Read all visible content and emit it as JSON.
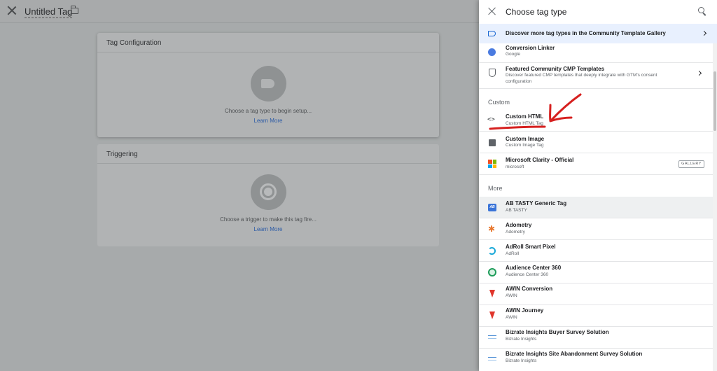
{
  "editor": {
    "tag_title": "Untitled Tag",
    "config_card": {
      "title": "Tag Configuration",
      "hint": "Choose a tag type to begin setup...",
      "link": "Learn More"
    },
    "trigger_card": {
      "title": "Triggering",
      "hint": "Choose a trigger to make this tag fire...",
      "link": "Learn More"
    }
  },
  "panel": {
    "title": "Choose tag type",
    "gallery_banner": "Discover more tag types in the Community Template Gallery",
    "featured": [
      {
        "title": "Conversion Linker",
        "sub": "Google",
        "icon": "link-icon"
      },
      {
        "title": "Featured Community CMP Templates",
        "sub": "Discover featured CMP templates that deeply integrate with GTM's consent configuration",
        "icon": "shield-icon"
      }
    ],
    "custom_label": "Custom",
    "custom": [
      {
        "title": "Custom HTML",
        "sub": "Custom HTML Tag",
        "icon": "code-icon"
      },
      {
        "title": "Custom Image",
        "sub": "Custom Image Tag",
        "icon": "image-icon"
      },
      {
        "title": "Microsoft Clarity - Official",
        "sub": "microsoft",
        "icon": "microsoft-logo-icon",
        "badge": "GALLERY"
      }
    ],
    "more_label": "More",
    "more": [
      {
        "title": "AB TASTY Generic Tag",
        "sub": "AB TASTY",
        "icon": "abtasty-logo-icon",
        "icon_text": "AB"
      },
      {
        "title": "Adometry",
        "sub": "Adometry",
        "icon": "adometry-logo-icon"
      },
      {
        "title": "AdRoll Smart Pixel",
        "sub": "AdRoll",
        "icon": "adroll-logo-icon"
      },
      {
        "title": "Audience Center 360",
        "sub": "Audience Center 360",
        "icon": "audience-center-logo-icon"
      },
      {
        "title": "AWIN Conversion",
        "sub": "AWIN",
        "icon": "awin-logo-icon"
      },
      {
        "title": "AWIN Journey",
        "sub": "AWIN",
        "icon": "awin-logo-icon"
      },
      {
        "title": "Bizrate Insights Buyer Survey Solution",
        "sub": "Bizrate Insights",
        "icon": "bizrate-logo-icon"
      },
      {
        "title": "Bizrate Insights Site Abandonment Survey Solution",
        "sub": "Bizrate Insights",
        "icon": "bizrate-logo-icon"
      }
    ]
  },
  "colors": {
    "overlay": "#a7aaab",
    "accent_blue": "#1967d2",
    "annotation_red": "#d6201f",
    "banner_bg": "#e8f0fe"
  }
}
